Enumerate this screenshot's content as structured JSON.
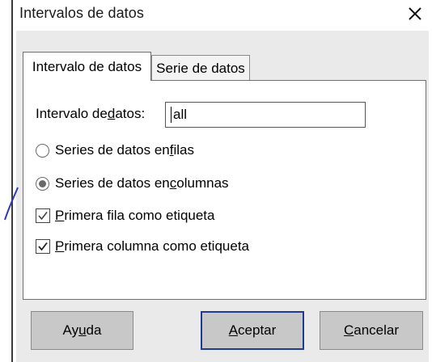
{
  "window": {
    "title": "Intervalos de datos",
    "close_icon": "close-icon"
  },
  "tabs": [
    {
      "label": "Intervalo de datos",
      "active": true
    },
    {
      "label": "Serie de datos",
      "active": false
    }
  ],
  "range": {
    "label_pre": "Intervalo de ",
    "label_underlined": "d",
    "label_post": "atos:",
    "value": "all"
  },
  "options": {
    "rows": {
      "pre": "Series de datos en ",
      "u": "f",
      "post": "ilas",
      "selected": false
    },
    "columns": {
      "pre": "Series de datos en ",
      "u": "c",
      "post": "olumnas",
      "selected": true
    },
    "first_row": {
      "pre": "",
      "u": "P",
      "post": "rimera fila como etiqueta",
      "checked": true
    },
    "first_col": {
      "pre": "",
      "u": "P",
      "post": "rimera columna como etiqueta",
      "checked": true
    }
  },
  "buttons": {
    "help": {
      "pre": "Ay",
      "u": "u",
      "post": "da"
    },
    "ok": {
      "pre": "",
      "u": "A",
      "post": "ceptar"
    },
    "cancel": {
      "pre": "",
      "u": "C",
      "post": "ancelar"
    }
  },
  "colors": {
    "accent": "#1f3a93",
    "panel": "#eaeaea",
    "button": "#c8c8c8"
  }
}
